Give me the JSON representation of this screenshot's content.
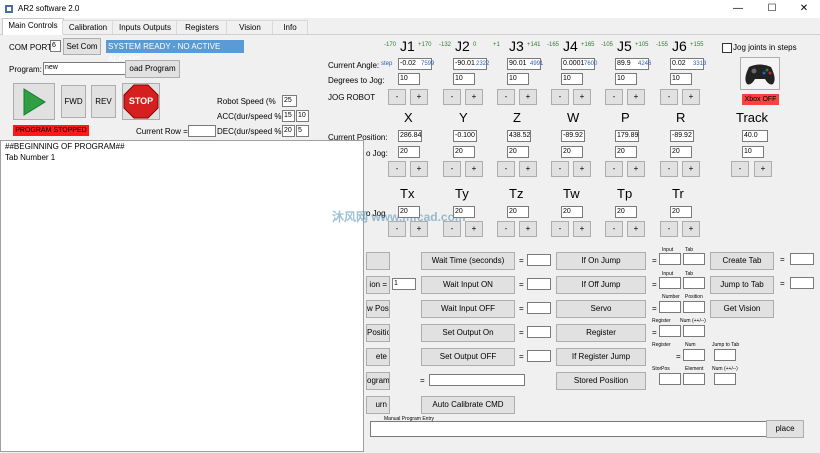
{
  "window": {
    "title": "AR2 software 2.0",
    "minimize": "—",
    "maximize": "☐",
    "close": "✕"
  },
  "tabs": [
    "Main Controls",
    "Calibration",
    "Inputs Outputs",
    "Registers",
    "Vision",
    "Info"
  ],
  "left": {
    "com_port_label": "COM PORT",
    "com_port_value": "6",
    "set_com": "Set Com",
    "status": "SYSTEM READY - NO ACTIVE ALARMS",
    "program_label": "Program:",
    "program_value": "new",
    "load_program": "oad Program",
    "fwd": "FWD",
    "rev": "REV",
    "stop": "STOP",
    "program_status": "PROGRAM STOPPED",
    "robot_speed_label": "Robot Speed    (%",
    "robot_speed": "25",
    "acc_label": "ACC(dur/speed %",
    "acc1": "15",
    "acc2": "10",
    "dec_label": "DEC(dur/speed %",
    "dec1": "20",
    "dec2": "5",
    "current_row_label": "Current Row   =",
    "program_lines": [
      "##BEGINNING OF PROGRAM##",
      "Tab Number 1"
    ]
  },
  "joints": {
    "current_angle_label": "Current Angle:",
    "degrees_label": "Degrees to Jog:",
    "jog_robot_label": "JOG ROBOT",
    "step_label": "step",
    "items": [
      {
        "name": "J1",
        "neg": "-170",
        "pos": "+170",
        "angle": "-0.02",
        "step": "7599",
        "jog": "10"
      },
      {
        "name": "J2",
        "neg": "-132",
        "pos": "0",
        "angle": "-90.01",
        "step": "2322",
        "jog": "10"
      },
      {
        "name": "J3",
        "neg": "+1",
        "pos": "+141",
        "angle": "90.01",
        "step": "4991",
        "jog": "10"
      },
      {
        "name": "J4",
        "neg": "-165",
        "pos": "+165",
        "angle": "0.0001",
        "step": "7600",
        "jog": "10"
      },
      {
        "name": "J5",
        "neg": "-105",
        "pos": "+105",
        "angle": "89.9",
        "step": "4246",
        "jog": "10"
      },
      {
        "name": "J6",
        "neg": "-155",
        "pos": "+155",
        "angle": "0.02",
        "step": "3313",
        "jog": "10"
      }
    ],
    "jog_in_steps": "Jog joints in steps",
    "xbox": "Xbox OFF",
    "minus": "-",
    "plus": "+"
  },
  "cartesian": {
    "current_position_label": "Current Position:",
    "to_jog_label": "o Jog:",
    "axes": [
      {
        "name": "X",
        "pos": "286.84",
        "jog": "20"
      },
      {
        "name": "Y",
        "pos": "-0.100",
        "jog": "20"
      },
      {
        "name": "Z",
        "pos": "438.52",
        "jog": "20"
      },
      {
        "name": "W",
        "pos": "-89.92",
        "jog": "20"
      },
      {
        "name": "P",
        "pos": "179.89",
        "jog": "20"
      },
      {
        "name": "R",
        "pos": "-89.92",
        "jog": "20"
      }
    ],
    "track": {
      "name": "Track",
      "pos": "40.0",
      "jog": "10"
    },
    "tool_axes": [
      {
        "name": "Tx",
        "jog": "20"
      },
      {
        "name": "Ty",
        "jog": "20"
      },
      {
        "name": "Tz",
        "jog": "20"
      },
      {
        "name": "Tw",
        "jog": "20"
      },
      {
        "name": "Tp",
        "jog": "20"
      },
      {
        "name": "Tr",
        "jog": "20"
      }
    ],
    "tool_jog_label": "o Jog"
  },
  "commands": {
    "left_col": [
      "",
      "ion  =",
      "w Position",
      "Position",
      "ete",
      "ogram",
      "urn"
    ],
    "left_col_value": "1",
    "col2": [
      "Wait Time (seconds)",
      "Wait Input ON",
      "Wait Input OFF",
      "Set Output On",
      "Set Output OFF"
    ],
    "ogram_entry_label": "=",
    "auto_cal": "Auto Calibrate CMD",
    "col3": [
      "If On Jump",
      "If Off Jump",
      "Servo",
      "Register",
      "If Register Jump",
      "Stored Position"
    ],
    "eq": "=",
    "input_lbl": "Input",
    "tab_lbl": "Tab",
    "number_lbl": "Number",
    "position_lbl": "Position",
    "register_lbl": "Register",
    "num_lbl": "Num (++/--)",
    "num2_lbl": "Num",
    "jump_to_tab_lbl": "Jump to Tab",
    "storpos_lbl": "StorPos",
    "element_lbl": "Element",
    "col4": [
      "Create Tab",
      "Jump to Tab",
      "Get Vision"
    ],
    "manual_entry_label": "Manual Program Entry",
    "replace": "place"
  },
  "watermark": "沐风网 www.mfcad.com"
}
